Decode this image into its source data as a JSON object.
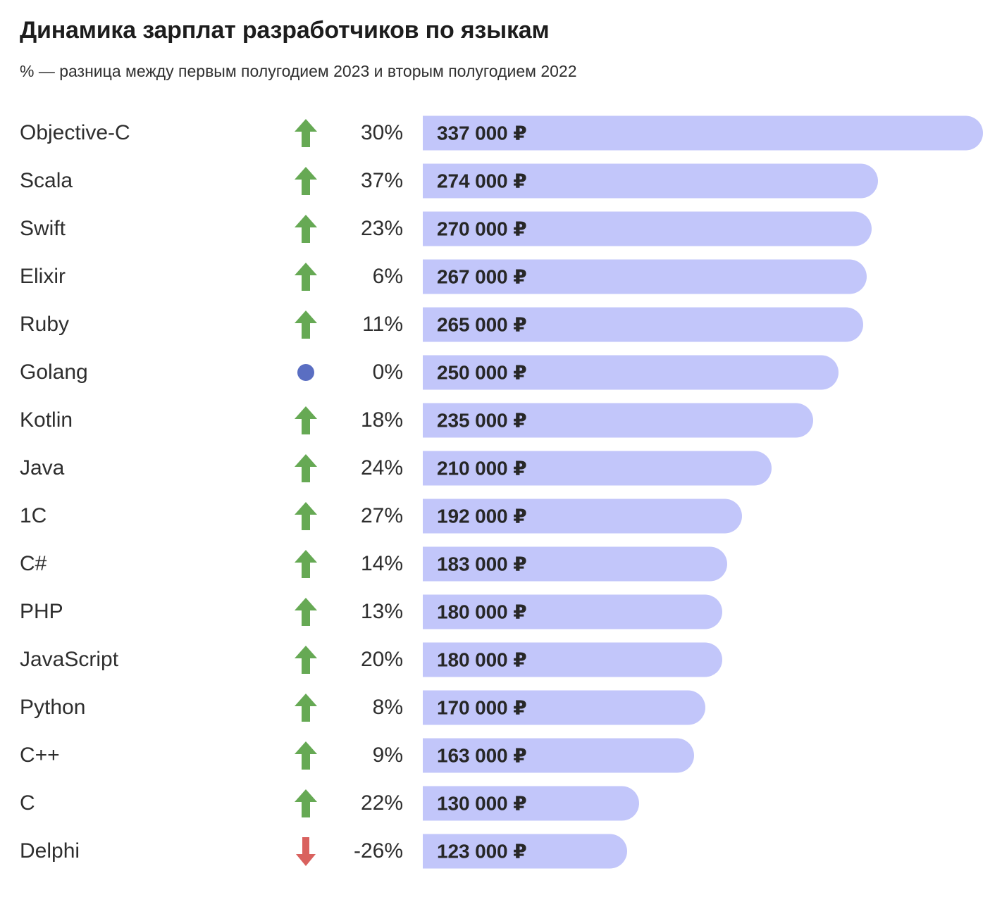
{
  "header": {
    "title": "Динамика зарплат разработчиков по языкам",
    "subtitle": "% — разница между первым полугодием 2023 и вторым полугодием 2022"
  },
  "colors": {
    "bar_fill": "#c2c6fa",
    "arrow_up": "#66a954",
    "arrow_down": "#d9615e",
    "dot_flat": "#5a6ec2",
    "text": "#2e2e2e"
  },
  "icons": {
    "up": "arrow-up-icon",
    "down": "arrow-down-icon",
    "flat": "dot-flat-icon"
  },
  "chart_data": {
    "type": "bar",
    "orientation": "horizontal",
    "title": "Динамика зарплат разработчиков по языкам",
    "subtitle": "% — разница между первым полугодием 2023 и вторым полугодием 2022",
    "xlabel": "",
    "ylabel": "",
    "grid": false,
    "legend": false,
    "unit": "₽",
    "xlim": [
      0,
      337000
    ],
    "categories": [
      "Objective-C",
      "Scala",
      "Swift",
      "Elixir",
      "Ruby",
      "Golang",
      "Kotlin",
      "Java",
      "1C",
      "C#",
      "PHP",
      "JavaScript",
      "Python",
      "C++",
      "C",
      "Delphi"
    ],
    "values": [
      337000,
      274000,
      270000,
      267000,
      265000,
      250000,
      235000,
      210000,
      192000,
      183000,
      180000,
      180000,
      170000,
      163000,
      130000,
      123000
    ],
    "change_percent": [
      30,
      37,
      23,
      6,
      11,
      0,
      18,
      24,
      27,
      14,
      13,
      20,
      8,
      9,
      22,
      -26
    ],
    "rows": [
      {
        "language": "Objective-C",
        "trend": "up",
        "percent_label": "30%",
        "value": 337000,
        "value_label": "337 000 ₽"
      },
      {
        "language": "Scala",
        "trend": "up",
        "percent_label": "37%",
        "value": 274000,
        "value_label": "274 000 ₽"
      },
      {
        "language": "Swift",
        "trend": "up",
        "percent_label": "23%",
        "value": 270000,
        "value_label": "270 000 ₽"
      },
      {
        "language": "Elixir",
        "trend": "up",
        "percent_label": "6%",
        "value": 267000,
        "value_label": "267 000 ₽"
      },
      {
        "language": "Ruby",
        "trend": "up",
        "percent_label": "11%",
        "value": 265000,
        "value_label": "265 000 ₽"
      },
      {
        "language": "Golang",
        "trend": "flat",
        "percent_label": "0%",
        "value": 250000,
        "value_label": "250 000 ₽"
      },
      {
        "language": "Kotlin",
        "trend": "up",
        "percent_label": "18%",
        "value": 235000,
        "value_label": "235 000 ₽"
      },
      {
        "language": "Java",
        "trend": "up",
        "percent_label": "24%",
        "value": 210000,
        "value_label": "210 000 ₽"
      },
      {
        "language": "1C",
        "trend": "up",
        "percent_label": "27%",
        "value": 192000,
        "value_label": "192 000 ₽"
      },
      {
        "language": "C#",
        "trend": "up",
        "percent_label": "14%",
        "value": 183000,
        "value_label": "183 000 ₽"
      },
      {
        "language": "PHP",
        "trend": "up",
        "percent_label": "13%",
        "value": 180000,
        "value_label": "180 000 ₽"
      },
      {
        "language": "JavaScript",
        "trend": "up",
        "percent_label": "20%",
        "value": 180000,
        "value_label": "180 000 ₽"
      },
      {
        "language": "Python",
        "trend": "up",
        "percent_label": "8%",
        "value": 170000,
        "value_label": "170 000 ₽"
      },
      {
        "language": "C++",
        "trend": "up",
        "percent_label": "9%",
        "value": 163000,
        "value_label": "163 000 ₽"
      },
      {
        "language": "C",
        "trend": "up",
        "percent_label": "22%",
        "value": 130000,
        "value_label": "130 000 ₽"
      },
      {
        "language": "Delphi",
        "trend": "down",
        "percent_label": "-26%",
        "value": 123000,
        "value_label": "123 000 ₽"
      }
    ]
  }
}
